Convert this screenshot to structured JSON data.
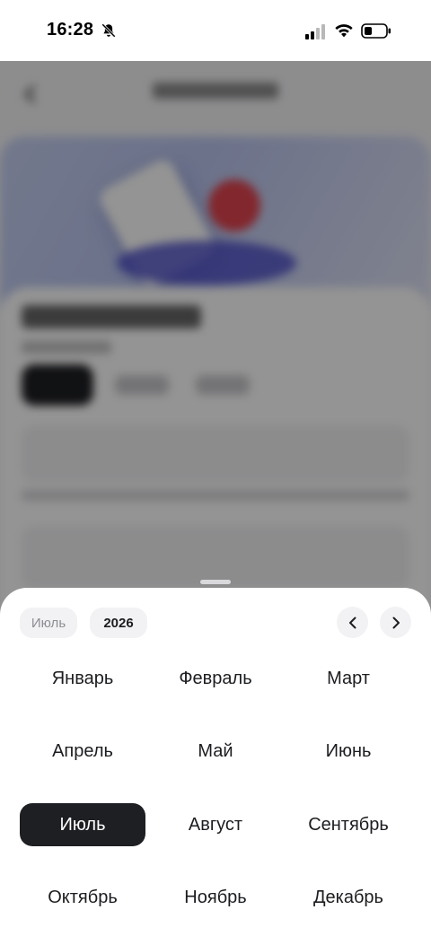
{
  "status_bar": {
    "time": "16:28",
    "icons": [
      "bell-off-icon",
      "cellular-signal-icon",
      "wifi-icon",
      "battery-icon"
    ]
  },
  "picker": {
    "selected_month_chip": "Июль",
    "selected_year_chip": "2026",
    "prev_icon": "chevron-left-icon",
    "next_icon": "chevron-right-icon",
    "selected_month": "Июль",
    "months": [
      "Январь",
      "Февраль",
      "Март",
      "Апрель",
      "Май",
      "Июнь",
      "Июль",
      "Август",
      "Сентябрь",
      "Октябрь",
      "Ноябрь",
      "Декабрь"
    ]
  },
  "colors": {
    "selected_bg": "#1e1f23",
    "chip_bg": "#f2f2f4",
    "overlay": "rgba(0,0,0,0.42)"
  }
}
